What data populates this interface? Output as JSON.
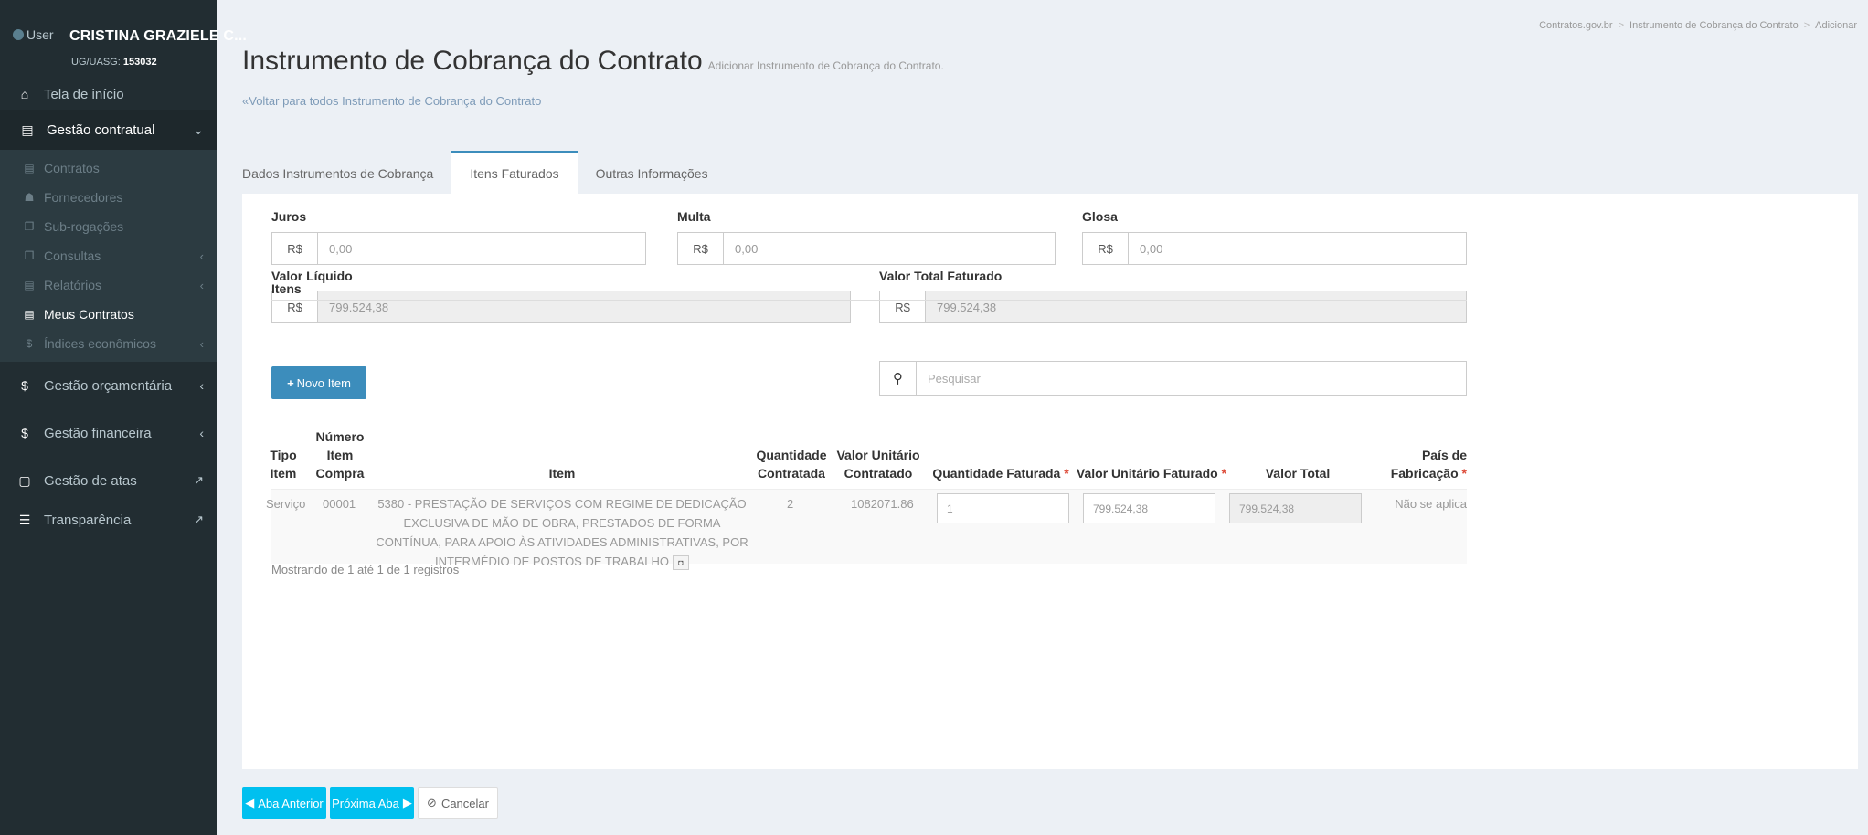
{
  "sidebar": {
    "user_label": "User",
    "user_name": "CRISTINA GRAZIELE C...",
    "uasg_label": "UG/UASG:",
    "uasg_value": "153032",
    "items": {
      "home": "Tela de início",
      "gestao_contratual": "Gestão contratual",
      "contratos": "Contratos",
      "fornecedores": "Fornecedores",
      "subrogacoes": "Sub-rogações",
      "consultas": "Consultas",
      "relatorios": "Relatórios",
      "meus_contratos": "Meus Contratos",
      "indices": "Índices econômicos",
      "gestao_orcamentaria": "Gestão orçamentária",
      "gestao_financeira": "Gestão financeira",
      "gestao_atas": "Gestão de atas",
      "transparencia": "Transparência"
    }
  },
  "breadcrumb": [
    "Contratos.gov.br",
    "Instrumento de Cobrança do Contrato",
    "Adicionar"
  ],
  "page": {
    "title": "Instrumento de Cobrança do Contrato",
    "subtitle": "Adicionar Instrumento de Cobrança do Contrato.",
    "back_link": "Voltar para todos Instrumento de Cobrança do Contrato"
  },
  "tabs": [
    "Dados Instrumentos de Cobrança",
    "Itens Faturados",
    "Outras Informações"
  ],
  "form": {
    "currency": "R$",
    "juros_label": "Juros",
    "juros_value": "0,00",
    "multa_label": "Multa",
    "multa_value": "0,00",
    "glosa_label": "Glosa",
    "glosa_value": "0,00",
    "valor_liquido_label": "Valor Líquido",
    "valor_liquido_value": "799.524,38",
    "valor_total_label": "Valor Total Faturado",
    "valor_total_value": "799.524,38",
    "itens_label": "Itens"
  },
  "toolbar": {
    "novo_item": "Novo Item",
    "search_placeholder": "Pesquisar"
  },
  "table": {
    "headers": {
      "tipo_item_1": "Tipo",
      "tipo_item_2": "Item",
      "numero_1": "Número",
      "numero_2": "Item",
      "numero_3": "Compra",
      "item": "Item",
      "qtd_contr_1": "Quantidade",
      "qtd_contr_2": "Contratada",
      "vu_contr_1": "Valor Unitário",
      "vu_contr_2": "Contratado",
      "qtd_fat": "Quantidade Faturada",
      "vu_fat": "Valor Unitário Faturado",
      "valor_total": "Valor Total",
      "pais_1": "País de",
      "pais_2": "Fabricação"
    },
    "required_mark": "*",
    "rows": [
      {
        "tipo": "Serviço",
        "numero": "00001",
        "item": "5380 - PRESTAÇÃO DE SERVIÇOS COM REGIME DE DEDICAÇÃO EXCLUSIVA DE MÃO DE OBRA, PRESTADOS DE FORMA CONTÍNUA, PARA APOIO ÀS ATIVIDADES ADMINISTRATIVAS, POR INTERMÉDIO DE POSTOS DE TRABALHO",
        "qtd_contratada": "2",
        "vu_contratado": "1082071.86",
        "qtd_faturada": "1",
        "vu_faturado": "799.524,38",
        "valor_total": "799.524,38",
        "pais": "Não se aplica"
      }
    ],
    "showing": "Mostrando de 1 até 1 de 1 registros"
  },
  "footer": {
    "prev": "Aba Anterior",
    "next": "Próxima Aba",
    "cancel": "Cancelar"
  }
}
